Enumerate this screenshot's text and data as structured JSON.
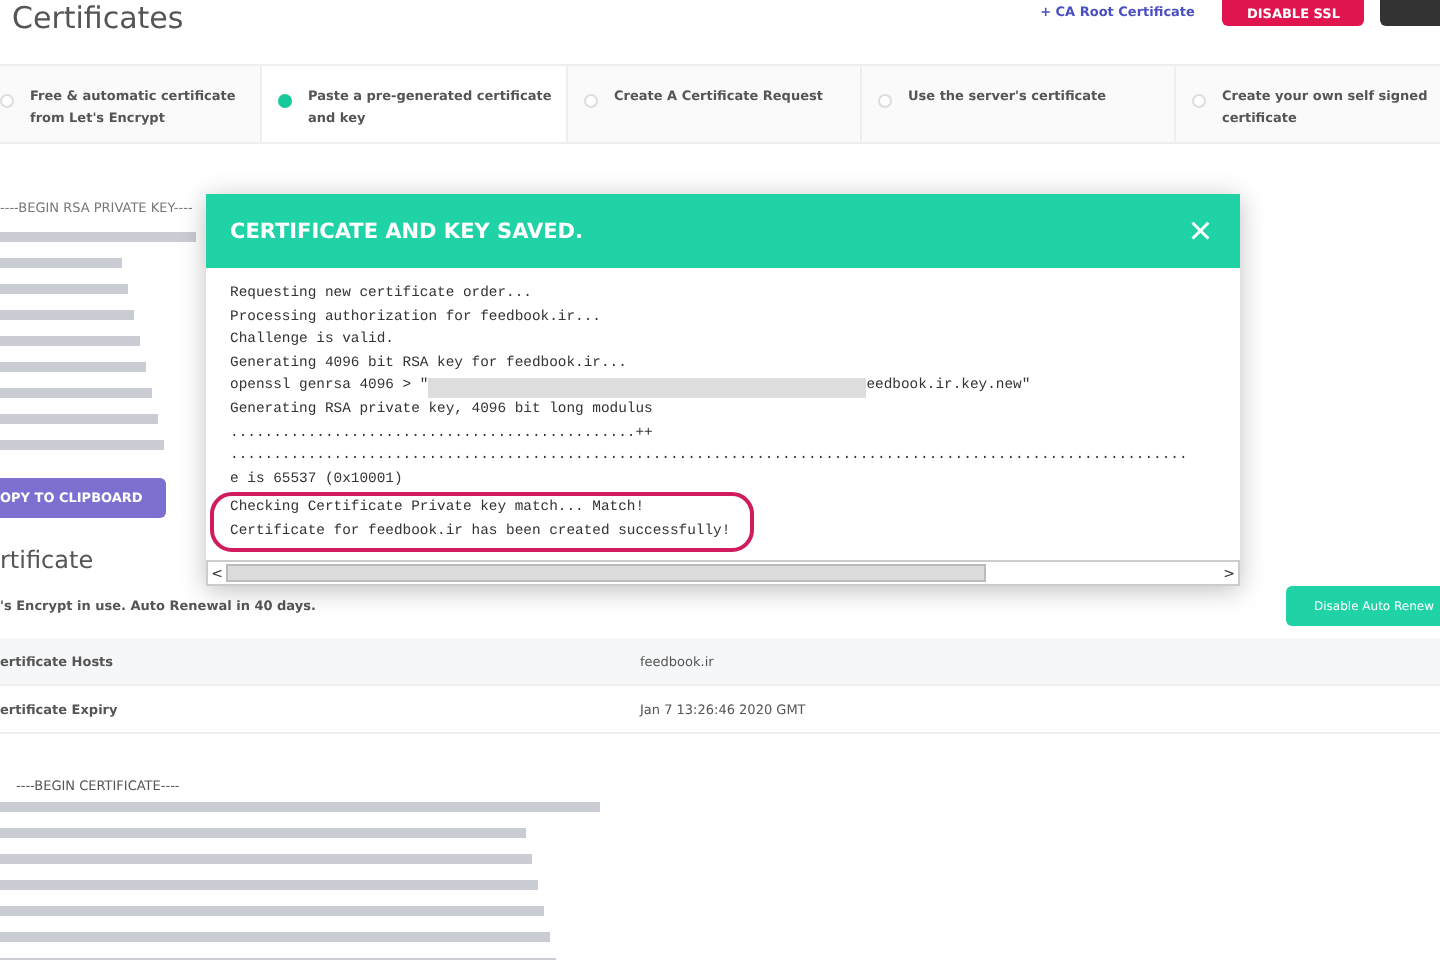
{
  "page": {
    "title": "Certificates",
    "ca_link": "+ CA Root Certificate",
    "disable_button": "DISABLE SSL"
  },
  "tabs": [
    {
      "label": "Free & automatic certificate from Let's Encrypt",
      "selected": false
    },
    {
      "label": "Paste a pre-generated certificate and key",
      "selected": true
    },
    {
      "label": "Create A Certificate Request",
      "selected": false
    },
    {
      "label": "Use the server's certificate",
      "selected": false
    },
    {
      "label": "Create your own self signed certificate",
      "selected": false
    }
  ],
  "private_key": {
    "header": "----BEGIN RSA PRIVATE KEY----",
    "copy_button": "OPY TO CLIPBOARD"
  },
  "certificate": {
    "heading": "rtificate",
    "notice": "'s Encrypt in use. Auto Renewal in 40 days.",
    "renew_button": "Disable Auto Renew",
    "rows": [
      {
        "label": "ertificate Hosts",
        "value": "feedbook.ir"
      },
      {
        "label": "ertificate Expiry",
        "value": "Jan 7 13:26:46 2020 GMT"
      }
    ],
    "cert_header": "----BEGIN CERTIFICATE----"
  },
  "modal": {
    "title": "CERTIFICATE AND KEY SAVED.",
    "close": "×",
    "log": [
      {
        "kind": "line",
        "text": "Requesting new certificate order..."
      },
      {
        "kind": "line",
        "text": "Processing authorization for feedbook.ir..."
      },
      {
        "kind": "line",
        "text": "Challenge is valid."
      },
      {
        "kind": "line",
        "text": "Generating 4096 bit RSA key for feedbook.ir..."
      },
      {
        "kind": "redacted",
        "text": "openssl genrsa 4096 > \"",
        "tail": "eedbook.ir.key.new\""
      },
      {
        "kind": "line",
        "text": "Generating RSA private key, 4096 bit long modulus"
      },
      {
        "kind": "line",
        "text": "...............................................++"
      },
      {
        "kind": "line",
        "text": "..............................................................................................................."
      },
      {
        "kind": "cut",
        "text": "e is 65537 (0x10001)"
      },
      {
        "kind": "highlight",
        "text": "Checking Certificate Private key match... Match!"
      },
      {
        "kind": "highlight",
        "text": "Certificate for feedbook.ir has been created successfully!"
      }
    ],
    "scroll_left": "<",
    "scroll_right": ">"
  }
}
